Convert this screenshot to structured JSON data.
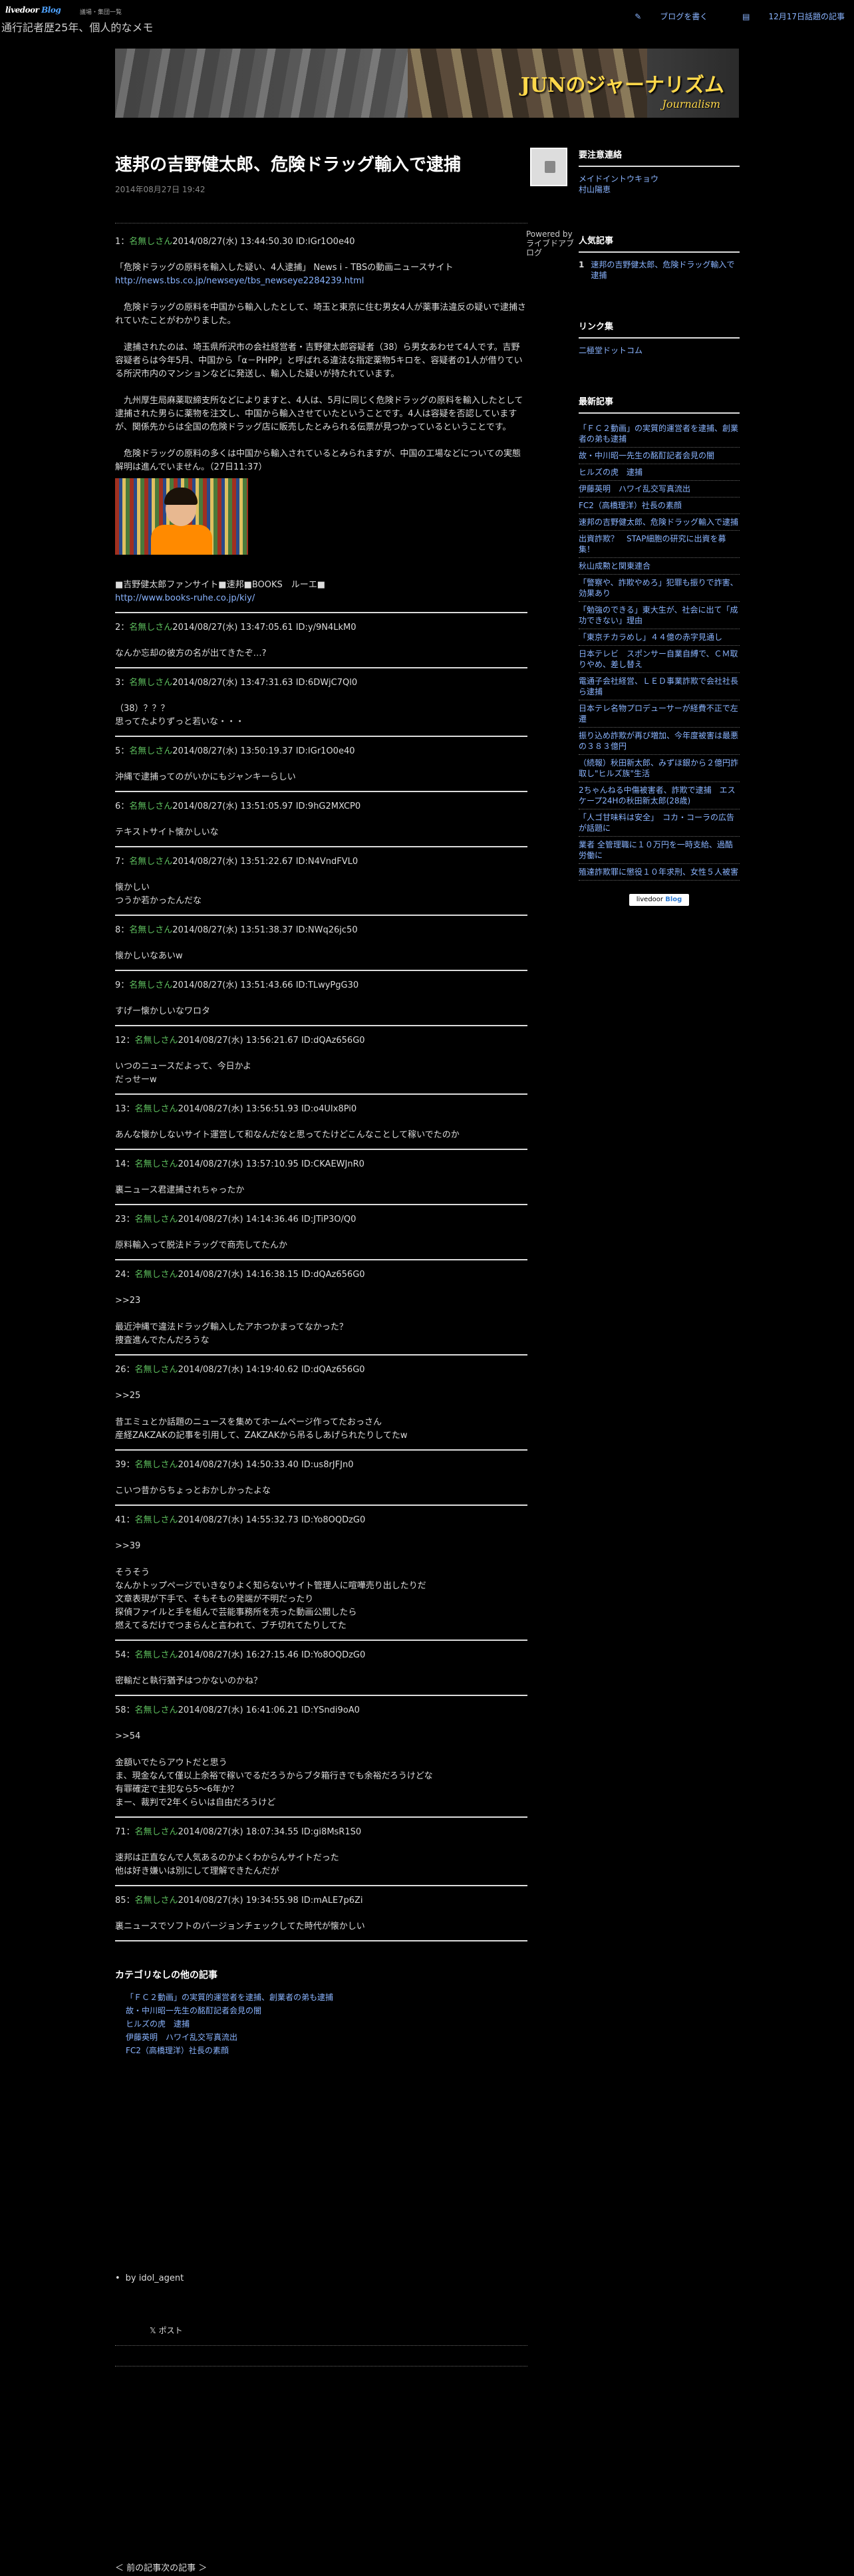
{
  "topbar": {
    "logo_main": "livedoor",
    "logo_blog": "Blog",
    "logo_sub": "議場・集団一覧",
    "tagline": "通行記者歴25年、個人的なメモ",
    "write_blog": "ブログを書く",
    "daily_ranking": "12月17日話題の記事"
  },
  "banner": {
    "title": "JUNのジャーナリズム",
    "subtitle": "Journalism"
  },
  "article": {
    "title": "速邦の吉野健太郎、危険ドラッグ輸入で逮捕",
    "date": "2014年08月27日 19:42",
    "first_meta": {
      "num": "1：",
      "name": "名無しさん",
      "info": "2014/08/27(水) 13:44:50.30 ID:IGr1O0e40"
    },
    "paras": [
      "「危険ドラッグの原料を輸入した疑い、4人逮捕」 News i - TBSの動画ニュースサイト",
      "　危険ドラッグの原料を中国から輸入したとして、埼玉と東京に住む男女4人が薬事法違反の疑いで逮捕されていたことがわかりました。",
      "　逮捕されたのは、埼玉県所沢市の会社経営者・吉野健太郎容疑者（38）ら男女あわせて4人です。吉野容疑者らは今年5月、中国から「α－PHPP」と呼ばれる違法な指定薬物5キロを、容疑者の1人が借りている所沢市内のマンションなどに発送し、輸入した疑いが持たれています。",
      "　九州厚生局麻薬取締支所などによりますと、4人は、5月に同じく危険ドラッグの原料を輸入したとして逮捕された男らに薬物を注文し、中国から輸入させていたということです。4人は容疑を否認していますが、関係先からは全国の危険ドラッグ店に販売したとみられる伝票が見つかっているということです。",
      "　危険ドラッグの原料の多くは中国から輸入されているとみられますが、中国の工場などについての実態解明は進んでいません。（27日11:37）"
    ],
    "news_link": "http://news.tbs.co.jp/newseye/tbs_newseye2284239.html",
    "fanclub": "■吉野健太郎ファンサイト■速邦■BOOKS　ルーエ■",
    "fanclub_link": "http://www.books-ruhe.co.jp/kiy/",
    "comments": [
      {
        "num": "2：",
        "name": "名無しさん",
        "info": "2014/08/27(水) 13:47:05.61 ID:y/9N4LkM0",
        "lines": [
          "なんか忘却の彼方の名が出てきたぞ…?"
        ]
      },
      {
        "num": "3：",
        "name": "名無しさん",
        "info": "2014/08/27(水) 13:47:31.63 ID:6DWjC7Ql0",
        "lines": [
          "（38）？？？",
          "思ってたよりずっと若いな・・・"
        ]
      },
      {
        "num": "5：",
        "name": "名無しさん",
        "info": "2014/08/27(水) 13:50:19.37 ID:IGr1O0e40",
        "lines": [
          "沖縄で逮捕ってのがいかにもジャンキーらしい"
        ]
      },
      {
        "num": "6：",
        "name": "名無しさん",
        "info": "2014/08/27(水) 13:51:05.97 ID:9hG2MXCP0",
        "lines": [
          "テキストサイト懐かしいな"
        ]
      },
      {
        "num": "7：",
        "name": "名無しさん",
        "info": "2014/08/27(水) 13:51:22.67 ID:N4VndFVL0",
        "lines": [
          "懐かしい",
          "つうか若かったんだな"
        ]
      },
      {
        "num": "8：",
        "name": "名無しさん",
        "info": "2014/08/27(水) 13:51:38.37 ID:NWq26jc50",
        "lines": [
          "懐かしいなあいw"
        ]
      },
      {
        "num": "9：",
        "name": "名無しさん",
        "info": "2014/08/27(水) 13:51:43.66 ID:TLwyPgG30",
        "lines": [
          "すげー懐かしいなワロタ"
        ]
      },
      {
        "num": "12：",
        "name": "名無しさん",
        "info": "2014/08/27(水) 13:56:21.67 ID:dQAz656G0",
        "lines": [
          "いつのニュースだよって、今日かよ",
          "だっせーw"
        ]
      },
      {
        "num": "13：",
        "name": "名無しさん",
        "info": "2014/08/27(水) 13:56:51.93 ID:o4UIx8Pi0",
        "lines": [
          "あんな懐かしないサイト運営して和なんだなと思ってたけどこんなことして稼いでたのか"
        ]
      },
      {
        "num": "14：",
        "name": "名無しさん",
        "info": "2014/08/27(水) 13:57:10.95 ID:CKAEWJnR0",
        "lines": [
          "裏ニュース君逮捕されちゃったか"
        ]
      },
      {
        "num": "23：",
        "name": "名無しさん",
        "info": "2014/08/27(水) 14:14:36.46 ID:JTiP3O/Q0",
        "lines": [
          "原料輸入って脱法ドラッグで商売してたんか"
        ]
      },
      {
        "num": "24：",
        "name": "名無しさん",
        "info": "2014/08/27(水) 14:16:38.15 ID:dQAz656G0",
        "lines": [
          ">>23",
          "",
          "最近沖縄で違法ドラッグ輸入したアホつかまってなかった？",
          "捜査進んでたんだろうな"
        ]
      },
      {
        "num": "26：",
        "name": "名無しさん",
        "info": "2014/08/27(水) 14:19:40.62 ID:dQAz656G0",
        "lines": [
          ">>25",
          "",
          "昔エミュとか話題のニュースを集めてホームページ作ってたおっさん",
          "産経ZAKZAKの記事を引用して、ZAKZAKから吊るしあげられたりしてたw"
        ]
      },
      {
        "num": "39：",
        "name": "名無しさん",
        "info": "2014/08/27(水) 14:50:33.40 ID:us8rJFJn0",
        "lines": [
          "こいつ昔からちょっとおかしかったよな"
        ]
      },
      {
        "num": "41：",
        "name": "名無しさん",
        "info": "2014/08/27(水) 14:55:32.73 ID:Yo8OQDzG0",
        "lines": [
          ">>39",
          "",
          "そうそう",
          "なんかトップページでいきなりよく知らないサイト管理人に喧嘩売り出したりだ",
          "文章表現が下手で、そもそもの発端が不明だったり",
          "探偵ファイルと手を組んで芸能事務所を売った動画公開したら",
          "燃えてるだけでつまらんと言われて、ブチ切れてたりしてた"
        ]
      },
      {
        "num": "54：",
        "name": "名無しさん",
        "info": "2014/08/27(水) 16:27:15.46 ID:Yo8OQDzG0",
        "lines": [
          "密輸だと執行猶予はつかないのかね？"
        ]
      },
      {
        "num": "58：",
        "name": "名無しさん",
        "info": "2014/08/27(水) 16:41:06.21 ID:YSndi9oA0",
        "lines": [
          ">>54",
          "",
          "金額いでたらアウトだと思う",
          "ま、現金なんて僅以上余裕で稼いでるだろうからブタ箱行きでも余裕だろうけどな",
          "有罪確定で主犯なら5〜6年か？",
          "まー、裁判で2年くらいは自由だろうけど"
        ]
      },
      {
        "num": "71：",
        "name": "名無しさん",
        "info": "2014/08/27(水) 18:07:34.55 ID:gi8MsR1S0",
        "lines": [
          "速邦は正直なんで人気あるのかよくわからんサイトだった",
          "他は好き嫌いは別にして理解できたんだが"
        ]
      },
      {
        "num": "85：",
        "name": "名無しさん",
        "info": "2014/08/27(水) 19:34:55.98 ID:mALE7p6Zi",
        "lines": [
          "裏ニュースでソフトのバージョンチェックしてた時代が懐かしい"
        ]
      }
    ]
  },
  "related": {
    "heading": "カテゴリなしの他の記事",
    "items": [
      "「ＦＣ２動画」の実質的運営者を逮捕、創業者の弟も逮捕",
      "故・中川昭一先生の酩酊記者会見の闇",
      "ヒルズの虎　逮捕",
      "伊藤英明　ハワイ乱交写真流出",
      "FC2（高橋理洋）社長の素顔"
    ]
  },
  "footer": {
    "by": "by idol_agent",
    "post_btn": "𝕏 ポスト",
    "pager": "＜ 前の記事次の記事 ＞"
  },
  "sidebar": {
    "powered": "Powered by ライブドアブログ",
    "contact_heading": "要注意連絡",
    "contact_items": [
      "メイドイントウキョウ",
      "村山陽恵"
    ],
    "popular_heading": "人気記事",
    "popular_items": [
      {
        "n": "1",
        "label": "速邦の吉野健太郎、危険ドラッグ輸入で逮捕"
      }
    ],
    "links_heading": "リンク集",
    "links_items": [
      "二極堂ドットコム"
    ],
    "recent_heading": "最新記事",
    "recent_items": [
      "「ＦＣ２動画」の実質的運営者を逮捕、創業者の弟も逮捕",
      "故・中川昭一先生の酩酊記者会見の闇",
      "ヒルズの虎　逮捕",
      "伊藤英明　ハワイ乱交写真流出",
      "FC2（高橋理洋）社長の素顔",
      "速邦の吉野健太郎、危険ドラッグ輸入で逮捕",
      "出資詐欺？　STAP細胞の研究に出資を募集！",
      "秋山成勲と関東連合",
      "「警察や、詐欺やめろ」犯罪も振りで詐害、効果あり",
      "「勉強のできる」東大生が、社会に出て「成功できない」理由",
      "「東京チカラめし」４４億の赤字見通し",
      "日本テレビ　スポンサー自業自縛で、ＣＭ取りやめ、差し替え",
      "電通子会社経営、ＬＥＤ事業詐欺で会社社長ら逮捕",
      "日本テレ名物プロデューサーが経費不正で左遷",
      "振り込め詐欺が再び増加、今年度被害は最悪の３８３億円",
      "（続報）秋田新太郎、みずほ銀から２億円詐取し\"ヒルズ族\"生活",
      "2ちゃんねる中傷被害者、詐欺で逮捕　エスケープ24Hの秋田新太郎(28歳)",
      "「人ゴ甘味料は安全」　コカ・コーラの広告が話題に",
      "業者 全管理職に１０万円を一時支給、過酷労働に",
      "殖達詐欺罪に懲役１０年求刑、女性５人被害"
    ],
    "badge_text": "livedoor",
    "badge_blog": "Blog"
  }
}
